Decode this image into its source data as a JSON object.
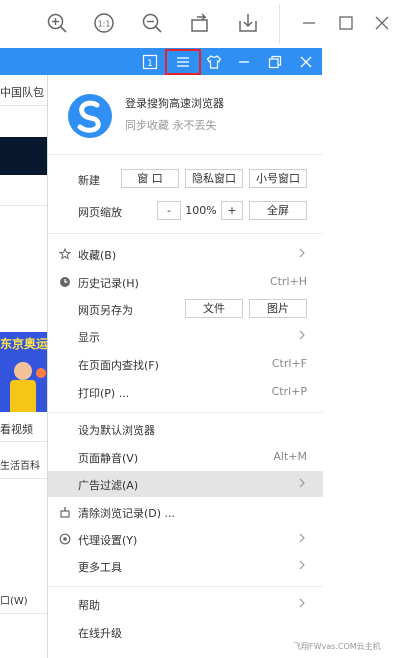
{
  "background_page": {
    "line1": "中国队包",
    "line2": "东京奥运",
    "line3": "看视频",
    "line4": "生活百科",
    "line5": "口(W)"
  },
  "bluebar": {
    "badge_number": "1"
  },
  "menu": {
    "login_title": "登录搜狗高速浏览器",
    "login_subtitle": "同步收藏 永不丢失",
    "new_label": "新建",
    "new_buttons": [
      "窗 口",
      "隐私窗口",
      "小号窗口"
    ],
    "zoom_label": "网页缩放",
    "zoom_minus": "-",
    "zoom_value": "100%",
    "zoom_plus": "+",
    "fullscreen": "全屏",
    "items": [
      {
        "label": "收藏(B)",
        "icon": "star-icon",
        "arrow": true
      },
      {
        "label": "历史记录(H)",
        "icon": "clock-icon",
        "shortcut": "Ctrl+H"
      },
      {
        "label": "网页另存为",
        "buttons": [
          "文件",
          "图片"
        ]
      },
      {
        "label": "显示",
        "arrow": true
      },
      {
        "label": "在页面内查找(F)",
        "shortcut": "Ctrl+F"
      },
      {
        "label": "打印(P) ...",
        "shortcut": "Ctrl+P"
      },
      {
        "label": "设为默认浏览器"
      },
      {
        "label": "页面静音(V)",
        "shortcut": "Alt+M"
      },
      {
        "label": "广告过滤(A)",
        "arrow": true,
        "active": true
      },
      {
        "label": "清除浏览记录(D) ...",
        "icon": "clear-icon"
      },
      {
        "label": "代理设置(Y)",
        "icon": "proxy-icon",
        "arrow": true
      },
      {
        "label": "更多工具",
        "arrow": true
      },
      {
        "label": "帮助",
        "arrow": true
      },
      {
        "label": "在线升级"
      }
    ]
  },
  "watermark": "飞翔FWvas.COM云主机",
  "colors": {
    "accent_blue": "#2f8ff3",
    "highlight_red": "#e5232a",
    "active_row": "#e4e4e4"
  }
}
